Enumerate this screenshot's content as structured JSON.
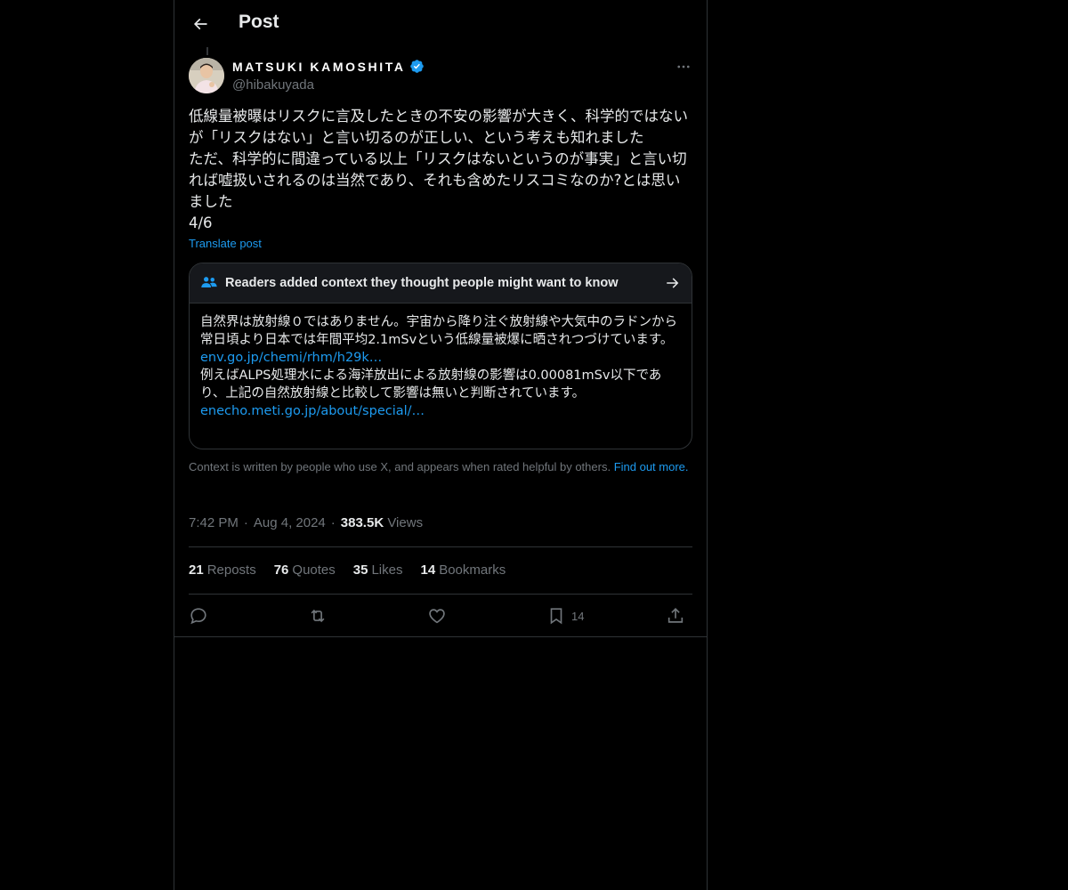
{
  "header": {
    "title": "Post"
  },
  "author": {
    "display_name": "MATSUKI KAMOSHITA",
    "handle": "@hibakuyada",
    "verified": true
  },
  "post": {
    "text": "低線量被曝はリスクに言及したときの不安の影響が大きく、科学的ではないが「リスクはない」と言い切るのが正しい、という考えも知れました\nただ、科学的に間違っている以上「リスクはないというのが事実」と言い切れば嘘扱いされるのは当然であり、それも含めたリスコミなのか?とは思いました\n4/6",
    "translate_label": "Translate post"
  },
  "community_note": {
    "title": "Readers added context they thought people might want to know",
    "paragraph1": "自然界は放射線０ではありません。宇宙から降り注ぐ放射線や大気中のラドンから常日頃より日本では年間平均2.1mSvという低線量被爆に晒されつづけています。",
    "link1": "env.go.jp/chemi/rhm/h29k…",
    "paragraph2": "例えばALPS処理水による海洋放出による放射線の影響は0.00081mSv以下であり、上記の自然放射線と比較して影響は無いと判断されています。",
    "link2": "enecho.meti.go.jp/about/special/…"
  },
  "context_footer": {
    "text": "Context is written by people who use X, and appears when rated helpful by others.",
    "find_out_more": "Find out more."
  },
  "meta": {
    "time": "7:42 PM",
    "date": "Aug 4, 2024",
    "views_count": "383.5K",
    "views_label": "Views",
    "separator": "·"
  },
  "stats": [
    {
      "count": "21",
      "label": "Reposts"
    },
    {
      "count": "76",
      "label": "Quotes"
    },
    {
      "count": "35",
      "label": "Likes"
    },
    {
      "count": "14",
      "label": "Bookmarks"
    }
  ],
  "actions": {
    "bookmark_count": "14"
  },
  "colors": {
    "background": "#000000",
    "accent": "#1d9bf0",
    "muted": "#71767b",
    "border": "#2f3336"
  }
}
